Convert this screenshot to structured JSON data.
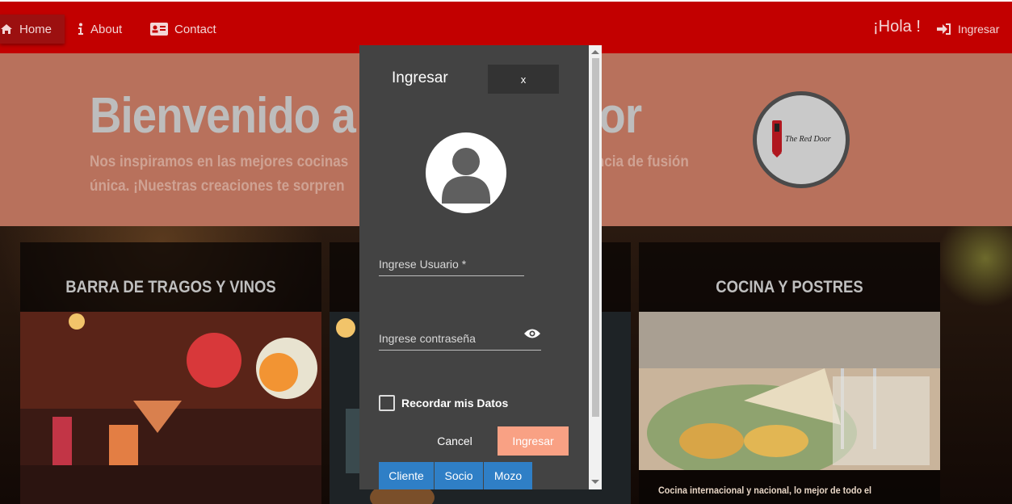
{
  "nav": {
    "home_label": "Home",
    "about_label": "About",
    "contact_label": "Contact",
    "greeting": "¡Hola !",
    "login_label": "Ingresar"
  },
  "hero": {
    "title": "Bienvenido a",
    "title_tail": "or",
    "subtitle_line1_a": "Nos inspiramos en las mejores cocinas",
    "subtitle_line1_b": "ncia de fusión",
    "subtitle_line2": "única. ¡Nuestras creaciones te sorpren",
    "logo_text": "The Red Door"
  },
  "cards": [
    {
      "title": "BARRA DE TRAGOS Y VINOS"
    },
    {
      "title": ""
    },
    {
      "title": "COCINA Y POSTRES",
      "description": "Cocina internacional y nacional, lo mejor de todo el"
    }
  ],
  "modal": {
    "title": "Ingresar",
    "close_label": "x",
    "username_placeholder": "Ingrese Usuario *",
    "password_placeholder": "Ingrese contraseña",
    "remember_label": "Recordar mis Datos",
    "cancel_label": "Cancel",
    "submit_label": "Ingresar",
    "roles": [
      "Cliente",
      "Socio",
      "Mozo"
    ]
  },
  "colors": {
    "navbar": "#c20000",
    "hero": "#b8715c",
    "modal": "#434343",
    "submit": "#f9a184",
    "role_button": "#2f7fc6"
  }
}
